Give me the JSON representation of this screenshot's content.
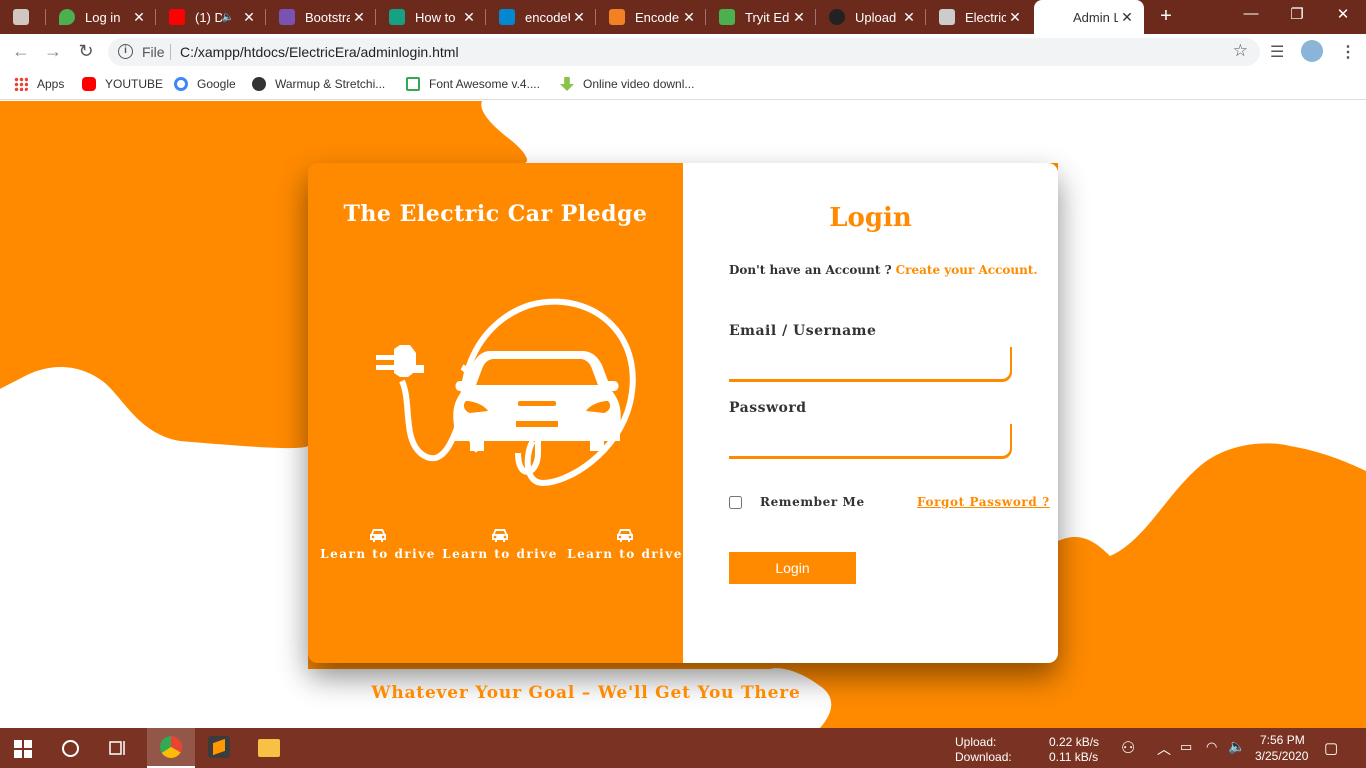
{
  "browser": {
    "tabs": [
      {
        "title": "",
        "color": "#d0c8c0"
      },
      {
        "title": "Log in",
        "color": "#4caf50"
      },
      {
        "title": "(1) D",
        "color": "#ff0000"
      },
      {
        "title": "Bootstra",
        "color": "#7952b3"
      },
      {
        "title": "How to",
        "color": "#16a085"
      },
      {
        "title": "encodeU",
        "color": "#0288d1"
      },
      {
        "title": "Encode",
        "color": "#f48024"
      },
      {
        "title": "Tryit Edi",
        "color": "#4caf50"
      },
      {
        "title": "Upload",
        "color": "#222222"
      },
      {
        "title": "Electric",
        "color": "#cccccc"
      },
      {
        "title": "Admin L",
        "color": "#ffffff"
      }
    ],
    "address": {
      "scheme_label": "File",
      "url": "C:/xampp/htdocs/ElectricEra/adminlogin.html"
    },
    "bookmarks": [
      {
        "label": "Apps",
        "color": "#ea4335"
      },
      {
        "label": "YOUTUBE",
        "color": "#ff0000"
      },
      {
        "label": "Google",
        "color": "#4285f4"
      },
      {
        "label": "Warmup & Stretchi...",
        "color": "#333333"
      },
      {
        "label": "Font Awesome v.4....",
        "color": "#34a853"
      },
      {
        "label": "Online video downl...",
        "color": "#8bc34a"
      }
    ]
  },
  "page": {
    "accent": "#ff8a00",
    "left_panel": {
      "title": "The Electric Car Pledge",
      "features": [
        "Learn to drive",
        "Learn to drive",
        "Learn to drive"
      ]
    },
    "form": {
      "title": "Login",
      "account_prompt": "Don't have an Account ?",
      "create_link": "Create your Account.",
      "email_label": "Email / Username",
      "password_label": "Password",
      "remember_label": "Remember Me",
      "forgot_link": "Forgot Password ?",
      "submit_label": "Login"
    },
    "tagline": "Whatever Your Goal – We'll Get You There"
  },
  "taskbar": {
    "upload_label": "Upload:",
    "upload_value": "0.22 kB/s",
    "download_label": "Download:",
    "download_value": "0.11 kB/s",
    "time": "7:56 PM",
    "date": "3/25/2020"
  }
}
